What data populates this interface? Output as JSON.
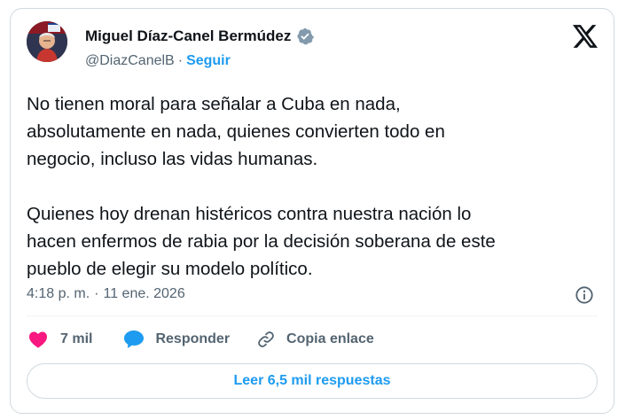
{
  "author": {
    "display_name": "Miguel Díaz-Canel Bermúdez",
    "handle": "@DiazCanelB",
    "separator": "·",
    "follow_label": "Seguir",
    "verified": true
  },
  "tweet": {
    "paragraphs": [
      [
        "No tienen moral para señalar a Cuba en nada,",
        "absolutamente en nada, quienes convierten todo en",
        "negocio, incluso las vidas humanas."
      ],
      [
        "Quienes hoy drenan histéricos contra nuestra nación lo",
        "hacen enfermos de rabia por la decisión soberana de este",
        "pueblo de elegir su modelo político."
      ]
    ],
    "time": "4:18 p. m.",
    "meta_separator": "·",
    "date": "11 ene. 2026"
  },
  "actions": {
    "like_count": "7 mil",
    "reply_label": "Responder",
    "copy_label": "Copia enlace"
  },
  "read_replies_label": "Leer 6,5 mil respuestas",
  "colors": {
    "accent": "#1d9bf0",
    "like": "#f91880",
    "text": "#0f1419",
    "muted": "#536471",
    "border": "#cfd9de"
  },
  "icons": {
    "verified": "verified-badge-icon",
    "platform": "x-logo-icon",
    "info": "info-icon",
    "like": "heart-icon",
    "reply": "speech-bubble-icon",
    "copy": "link-icon"
  }
}
